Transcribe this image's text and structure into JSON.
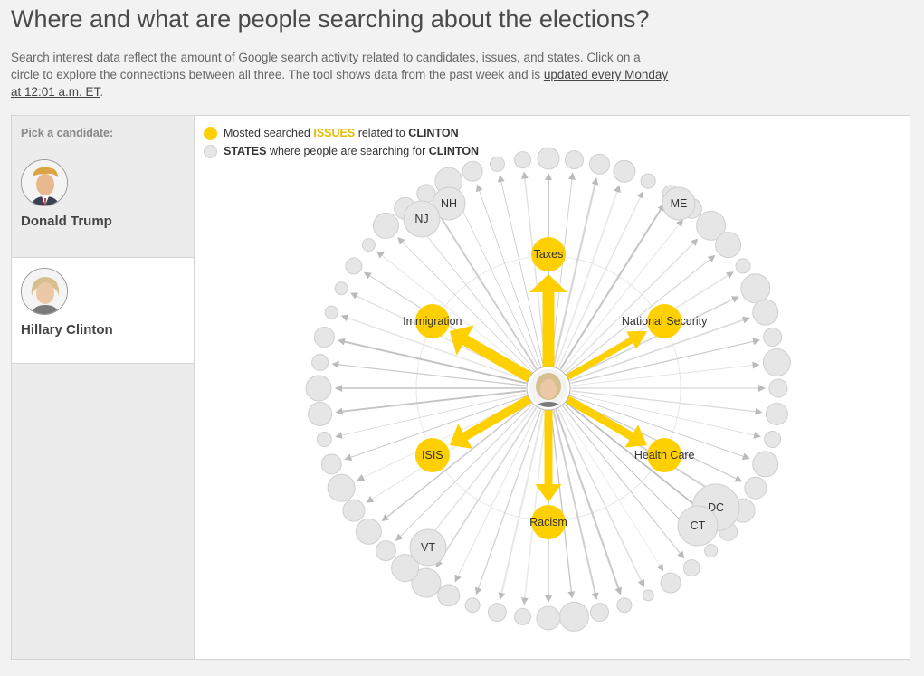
{
  "header": {
    "title": "Where and what are people searching about the elections?",
    "desc_part1": "Search interest data reflect the amount of Google search activity related to candidates, issues, and states. Click on a circle to explore the connections between all three. The tool shows data from the past week and is ",
    "desc_link": "updated every Monday at 12:01 a.m. ET",
    "desc_part2": "."
  },
  "sidebar": {
    "pick_label": "Pick a candidate:",
    "candidates": [
      {
        "name": "Donald Trump",
        "selected": false
      },
      {
        "name": "Hillary Clinton",
        "selected": true
      }
    ]
  },
  "legend": {
    "issues_prefix": "Mosted searched ",
    "issues_word": "ISSUES",
    "issues_suffix": " related to ",
    "states_word": "STATES",
    "states_suffix": " where people are searching for ",
    "candidate": "CLINTON",
    "issue_color": "#ffd000",
    "state_color": "#e6e6e6"
  },
  "issues": [
    "Taxes",
    "National Security",
    "Health Care",
    "Racism",
    "ISIS",
    "Immigration"
  ],
  "state_labels": [
    "NH",
    "NJ",
    "ME",
    "DC",
    "CT",
    "VT"
  ],
  "colors": {
    "accent": "#ffd000",
    "state_fill": "#e6e6e6",
    "state_stroke": "#cfcfcf",
    "arrow": "#cccccc"
  }
}
